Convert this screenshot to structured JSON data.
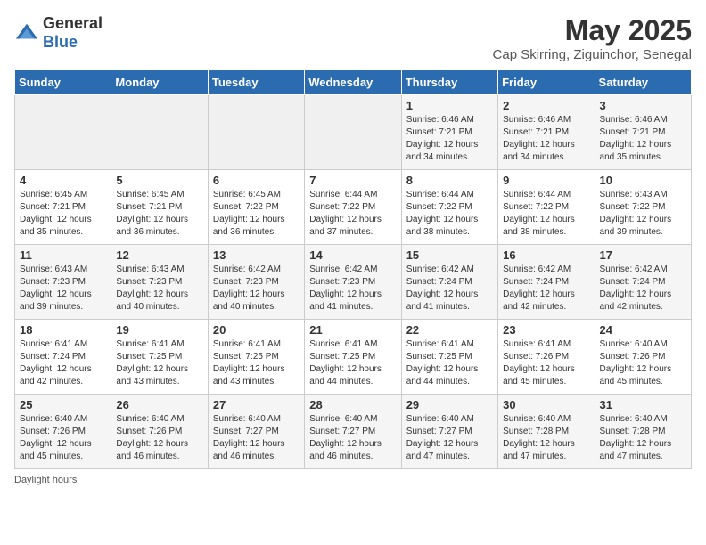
{
  "header": {
    "logo_general": "General",
    "logo_blue": "Blue",
    "month_year": "May 2025",
    "location": "Cap Skirring, Ziguinchor, Senegal"
  },
  "days_of_week": [
    "Sunday",
    "Monday",
    "Tuesday",
    "Wednesday",
    "Thursday",
    "Friday",
    "Saturday"
  ],
  "weeks": [
    [
      {
        "day": "",
        "info": ""
      },
      {
        "day": "",
        "info": ""
      },
      {
        "day": "",
        "info": ""
      },
      {
        "day": "",
        "info": ""
      },
      {
        "day": "1",
        "info": "Sunrise: 6:46 AM\nSunset: 7:21 PM\nDaylight: 12 hours\nand 34 minutes."
      },
      {
        "day": "2",
        "info": "Sunrise: 6:46 AM\nSunset: 7:21 PM\nDaylight: 12 hours\nand 34 minutes."
      },
      {
        "day": "3",
        "info": "Sunrise: 6:46 AM\nSunset: 7:21 PM\nDaylight: 12 hours\nand 35 minutes."
      }
    ],
    [
      {
        "day": "4",
        "info": "Sunrise: 6:45 AM\nSunset: 7:21 PM\nDaylight: 12 hours\nand 35 minutes."
      },
      {
        "day": "5",
        "info": "Sunrise: 6:45 AM\nSunset: 7:21 PM\nDaylight: 12 hours\nand 36 minutes."
      },
      {
        "day": "6",
        "info": "Sunrise: 6:45 AM\nSunset: 7:22 PM\nDaylight: 12 hours\nand 36 minutes."
      },
      {
        "day": "7",
        "info": "Sunrise: 6:44 AM\nSunset: 7:22 PM\nDaylight: 12 hours\nand 37 minutes."
      },
      {
        "day": "8",
        "info": "Sunrise: 6:44 AM\nSunset: 7:22 PM\nDaylight: 12 hours\nand 38 minutes."
      },
      {
        "day": "9",
        "info": "Sunrise: 6:44 AM\nSunset: 7:22 PM\nDaylight: 12 hours\nand 38 minutes."
      },
      {
        "day": "10",
        "info": "Sunrise: 6:43 AM\nSunset: 7:22 PM\nDaylight: 12 hours\nand 39 minutes."
      }
    ],
    [
      {
        "day": "11",
        "info": "Sunrise: 6:43 AM\nSunset: 7:23 PM\nDaylight: 12 hours\nand 39 minutes."
      },
      {
        "day": "12",
        "info": "Sunrise: 6:43 AM\nSunset: 7:23 PM\nDaylight: 12 hours\nand 40 minutes."
      },
      {
        "day": "13",
        "info": "Sunrise: 6:42 AM\nSunset: 7:23 PM\nDaylight: 12 hours\nand 40 minutes."
      },
      {
        "day": "14",
        "info": "Sunrise: 6:42 AM\nSunset: 7:23 PM\nDaylight: 12 hours\nand 41 minutes."
      },
      {
        "day": "15",
        "info": "Sunrise: 6:42 AM\nSunset: 7:24 PM\nDaylight: 12 hours\nand 41 minutes."
      },
      {
        "day": "16",
        "info": "Sunrise: 6:42 AM\nSunset: 7:24 PM\nDaylight: 12 hours\nand 42 minutes."
      },
      {
        "day": "17",
        "info": "Sunrise: 6:42 AM\nSunset: 7:24 PM\nDaylight: 12 hours\nand 42 minutes."
      }
    ],
    [
      {
        "day": "18",
        "info": "Sunrise: 6:41 AM\nSunset: 7:24 PM\nDaylight: 12 hours\nand 42 minutes."
      },
      {
        "day": "19",
        "info": "Sunrise: 6:41 AM\nSunset: 7:25 PM\nDaylight: 12 hours\nand 43 minutes."
      },
      {
        "day": "20",
        "info": "Sunrise: 6:41 AM\nSunset: 7:25 PM\nDaylight: 12 hours\nand 43 minutes."
      },
      {
        "day": "21",
        "info": "Sunrise: 6:41 AM\nSunset: 7:25 PM\nDaylight: 12 hours\nand 44 minutes."
      },
      {
        "day": "22",
        "info": "Sunrise: 6:41 AM\nSunset: 7:25 PM\nDaylight: 12 hours\nand 44 minutes."
      },
      {
        "day": "23",
        "info": "Sunrise: 6:41 AM\nSunset: 7:26 PM\nDaylight: 12 hours\nand 45 minutes."
      },
      {
        "day": "24",
        "info": "Sunrise: 6:40 AM\nSunset: 7:26 PM\nDaylight: 12 hours\nand 45 minutes."
      }
    ],
    [
      {
        "day": "25",
        "info": "Sunrise: 6:40 AM\nSunset: 7:26 PM\nDaylight: 12 hours\nand 45 minutes."
      },
      {
        "day": "26",
        "info": "Sunrise: 6:40 AM\nSunset: 7:26 PM\nDaylight: 12 hours\nand 46 minutes."
      },
      {
        "day": "27",
        "info": "Sunrise: 6:40 AM\nSunset: 7:27 PM\nDaylight: 12 hours\nand 46 minutes."
      },
      {
        "day": "28",
        "info": "Sunrise: 6:40 AM\nSunset: 7:27 PM\nDaylight: 12 hours\nand 46 minutes."
      },
      {
        "day": "29",
        "info": "Sunrise: 6:40 AM\nSunset: 7:27 PM\nDaylight: 12 hours\nand 47 minutes."
      },
      {
        "day": "30",
        "info": "Sunrise: 6:40 AM\nSunset: 7:28 PM\nDaylight: 12 hours\nand 47 minutes."
      },
      {
        "day": "31",
        "info": "Sunrise: 6:40 AM\nSunset: 7:28 PM\nDaylight: 12 hours\nand 47 minutes."
      }
    ]
  ],
  "footer": {
    "daylight_label": "Daylight hours"
  }
}
